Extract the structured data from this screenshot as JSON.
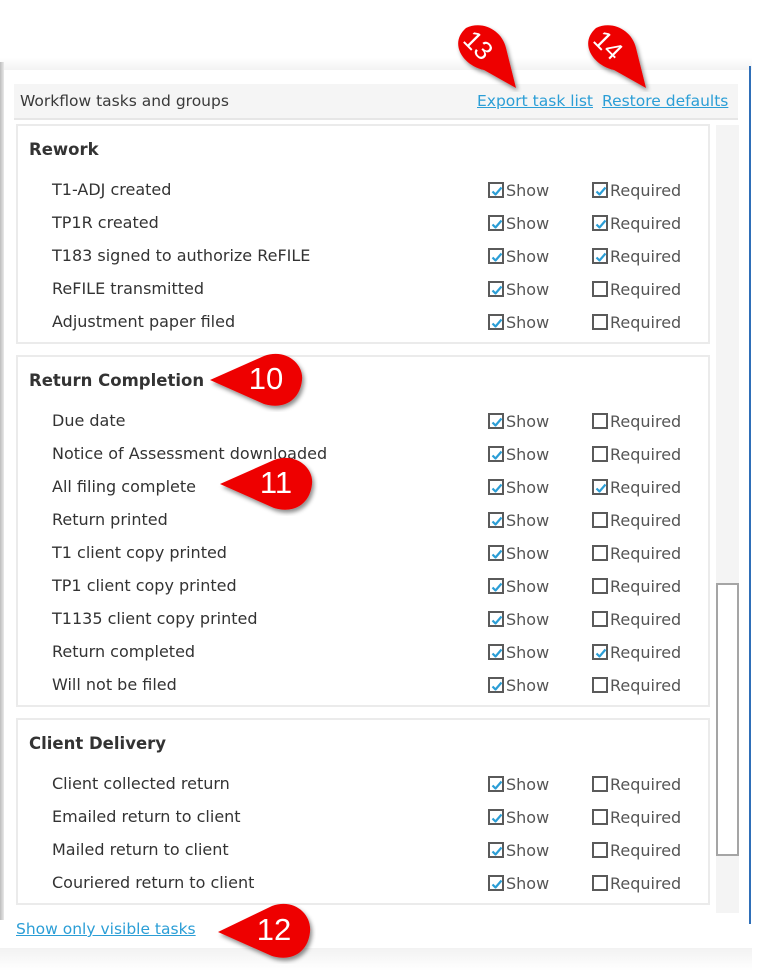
{
  "header": {
    "title": "Workflow tasks and groups",
    "export_link": "Export task list",
    "restore_link": "Restore defaults"
  },
  "checkbox_labels": {
    "show": "Show",
    "required": "Required"
  },
  "groups": [
    {
      "title": "Rework",
      "tasks": [
        {
          "label": "T1-ADJ created",
          "show": true,
          "required": true
        },
        {
          "label": "TP1R created",
          "show": true,
          "required": true
        },
        {
          "label": "T183 signed to authorize ReFILE",
          "show": true,
          "required": true
        },
        {
          "label": "ReFILE transmitted",
          "show": true,
          "required": false
        },
        {
          "label": "Adjustment paper filed",
          "show": true,
          "required": false
        }
      ]
    },
    {
      "title": "Return Completion",
      "tasks": [
        {
          "label": "Due date",
          "show": true,
          "required": false
        },
        {
          "label": "Notice of Assessment downloaded",
          "show": true,
          "required": false
        },
        {
          "label": "All filing complete",
          "show": true,
          "required": true
        },
        {
          "label": "Return printed",
          "show": true,
          "required": false
        },
        {
          "label": "T1 client copy printed",
          "show": true,
          "required": false
        },
        {
          "label": "TP1 client copy printed",
          "show": true,
          "required": false
        },
        {
          "label": "T1135 client copy printed",
          "show": true,
          "required": false
        },
        {
          "label": "Return completed",
          "show": true,
          "required": true
        },
        {
          "label": "Will not be filed",
          "show": true,
          "required": false
        }
      ]
    },
    {
      "title": "Client Delivery",
      "tasks": [
        {
          "label": "Client collected return",
          "show": true,
          "required": false
        },
        {
          "label": "Emailed return to client",
          "show": true,
          "required": false
        },
        {
          "label": "Mailed return to client",
          "show": true,
          "required": false
        },
        {
          "label": "Couriered return to client",
          "show": true,
          "required": false
        }
      ]
    }
  ],
  "footer": {
    "show_visible_link": "Show only visible tasks"
  },
  "callouts": {
    "c10": "10",
    "c11": "11",
    "c12": "12",
    "c13": "13",
    "c14": "14"
  },
  "colors": {
    "link": "#2b9ed6",
    "check": "#2b9ed6",
    "callout": "#ee0000",
    "accent_edge": "#2f6fb8"
  }
}
